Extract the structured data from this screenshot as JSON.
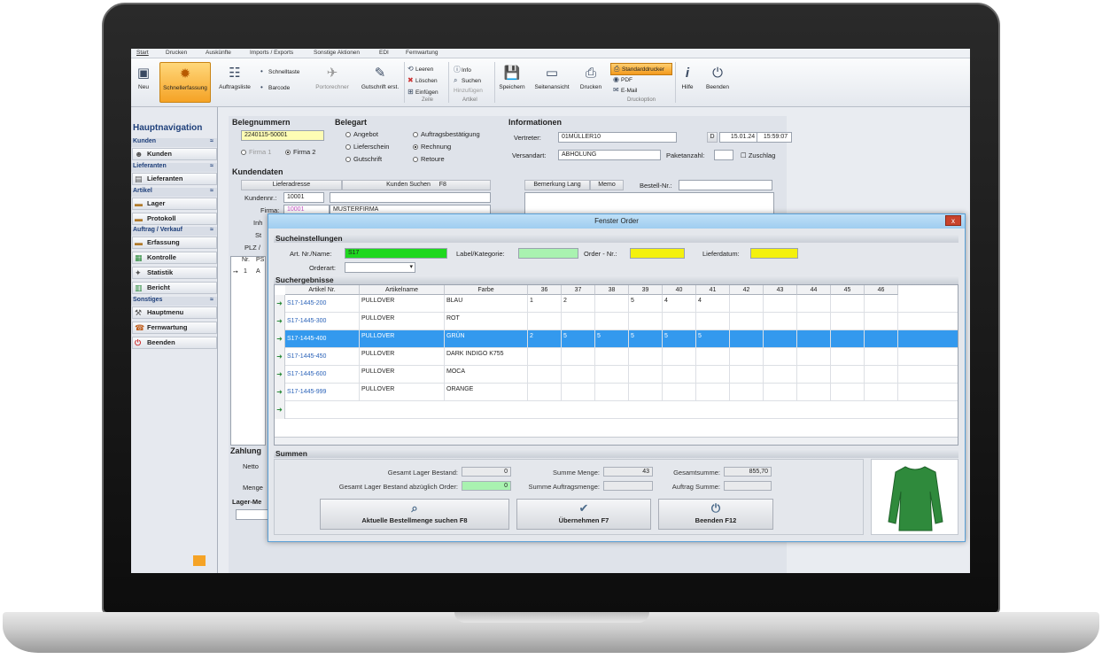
{
  "tabs": [
    "Start",
    "Drucken",
    "Auskünfte",
    "Imports / Exports",
    "Sonstige Aktionen",
    "EDI",
    "Fernwartung"
  ],
  "ribbon": {
    "neu": "Neu",
    "schnellerfassung": "Schnellerfassung",
    "auftragsliste": "Auftragsliste",
    "schnelltaste": "Schnelltaste",
    "barcode": "Barcode",
    "portorechner": "Portorechner",
    "gutschrift": "Gutschrift erst.",
    "leeren": "Leeren",
    "loeschen": "Löschen",
    "einfuegen": "Einfügen",
    "zeile": "Zeile",
    "info": "Info",
    "suchen": "Suchen",
    "hinzufuegen": "Hinzufügen",
    "artikel": "Artikel",
    "speichern": "Speichern",
    "seitenansicht": "Seitenansicht",
    "drucken": "Drucken",
    "standarddrucker": "Standarddrucker",
    "pdf": "PDF",
    "email": "E-Mail",
    "druckoption": "Druckoption",
    "hilfe": "Hilfe",
    "beenden": "Beenden"
  },
  "nav": {
    "title": "Hauptnavigation",
    "sections": {
      "kunden": "Kunden",
      "lieferanten": "Lieferanten",
      "artikel": "Artikel",
      "auftrag": "Auftrag / Verkauf",
      "sonstiges": "Sonstiges"
    },
    "items": {
      "kunden": "Kunden",
      "lieferanten": "Lieferanten",
      "lager": "Lager",
      "protokoll": "Protokoll",
      "erfassung": "Erfassung",
      "kontrolle": "Kontrolle",
      "statistik": "Statistik",
      "bericht": "Bericht",
      "hauptmenu": "Hauptmenu",
      "fernwartung": "Fernwartung",
      "beenden": "Beenden"
    }
  },
  "form": {
    "belegnummern": "Belegnummern",
    "belegnr": "2240115-50001",
    "firma1": "Firma 1",
    "firma2": "Firma 2",
    "belegart": "Belegart",
    "angebot": "Angebot",
    "lieferschein": "Lieferschein",
    "gutschrift": "Gutschrift",
    "auftragsbest": "Auftragsbestätigung",
    "rechnung": "Rechnung",
    "retoure": "Retoure",
    "informationen": "Informationen",
    "vertreter_lbl": "Vertreter:",
    "vertreter": "01MÜLLER10",
    "d_btn": "D",
    "datum": "15.01.24",
    "zeit": "15:59:07",
    "versandart_lbl": "Versandart:",
    "versandart": "ABHOLUNG",
    "paketanzahl": "Paketanzahl:",
    "zuschlag": "Zuschlag",
    "kundendaten": "Kundendaten",
    "lieferadresse": "Lieferadresse",
    "kundensuchen": "Kunden Suchen",
    "f8": "F8",
    "kundennr_lbl": "Kundennr.:",
    "kundennr": "10001",
    "firma_lbl": "Firma:",
    "firma_nr": "10001",
    "firma_name": "MUSTERFIRMA",
    "inh": "Inh",
    "str": "St",
    "plz": "PLZ /",
    "bemerkung": "Bemerkung Lang",
    "memo": "Memo",
    "bestellnr": "Bestell-Nr.:",
    "nr": "Nr.",
    "ps": "PS",
    "row1": "1",
    "row1b": "A",
    "zahlung": "Zahlung",
    "netto": "Netto",
    "menge": "Menge",
    "lagerme": "Lager-Me"
  },
  "dialog": {
    "title": "Fenster Order",
    "sucheinst": "Sucheinstellungen",
    "artnr_lbl": "Art. Nr./Name:",
    "artnr": "S17",
    "label_lbl": "Label/Kategorie:",
    "order_lbl": "Order - Nr.:",
    "lieferdatum": "Lieferdatum:",
    "orderart": "Orderart:",
    "suchergebnisse": "Suchergebnisse",
    "columns": [
      "Artikel Nr.",
      "Artikelname",
      "Farbe",
      "36",
      "37",
      "38",
      "39",
      "40",
      "41",
      "42",
      "43",
      "44",
      "45",
      "46"
    ],
    "rows": [
      {
        "nr": "S17-1445-200",
        "name": "PULLOVER",
        "farbe": "BLAU",
        "s": [
          "1",
          "2",
          "",
          "5",
          "4",
          "4",
          "",
          "",
          "",
          "",
          ""
        ]
      },
      {
        "nr": "S17-1445-300",
        "name": "PULLOVER",
        "farbe": "ROT",
        "s": [
          "",
          "",
          "",
          "",
          "",
          "",
          "",
          "",
          "",
          "",
          ""
        ]
      },
      {
        "nr": "S17-1445-400",
        "name": "PULLOVER",
        "farbe": "GRÜN",
        "s": [
          "2",
          "5",
          "5",
          "5",
          "5",
          "5",
          "",
          "",
          "",
          "",
          ""
        ]
      },
      {
        "nr": "S17-1445-450",
        "name": "PULLOVER",
        "farbe": "DARK INDIGO K755",
        "s": [
          "",
          "",
          "",
          "",
          "",
          "",
          "",
          "",
          "",
          "",
          ""
        ]
      },
      {
        "nr": "S17-1445-600",
        "name": "PULLOVER",
        "farbe": "MOCA",
        "s": [
          "",
          "",
          "",
          "",
          "",
          "",
          "",
          "",
          "",
          "",
          ""
        ]
      },
      {
        "nr": "S17-1445-999",
        "name": "PULLOVER",
        "farbe": "ORANGE",
        "s": [
          "",
          "",
          "",
          "",
          "",
          "",
          "",
          "",
          "",
          "",
          ""
        ]
      }
    ],
    "summen": "Summen",
    "ges_lager": "Gesamt Lager Bestand:",
    "ges_lager_v": "0",
    "ges_lager_abz": "Gesamt Lager Bestand abzüglich Order:",
    "ges_lager_abz_v": "0",
    "summe_menge": "Summe Menge:",
    "summe_menge_v": "43",
    "summe_auftrag": "Summe Auftragsmenge:",
    "gesamtsumme": "Gesamtsumme:",
    "gesamtsumme_v": "855,70",
    "auftrag_summe": "Auftrag Summe:",
    "btn_suchen": "Aktuelle Bestellmenge suchen F8",
    "btn_uebernehmen": "Übernehmen F7",
    "btn_beenden": "Beenden F12",
    "close": "x"
  }
}
